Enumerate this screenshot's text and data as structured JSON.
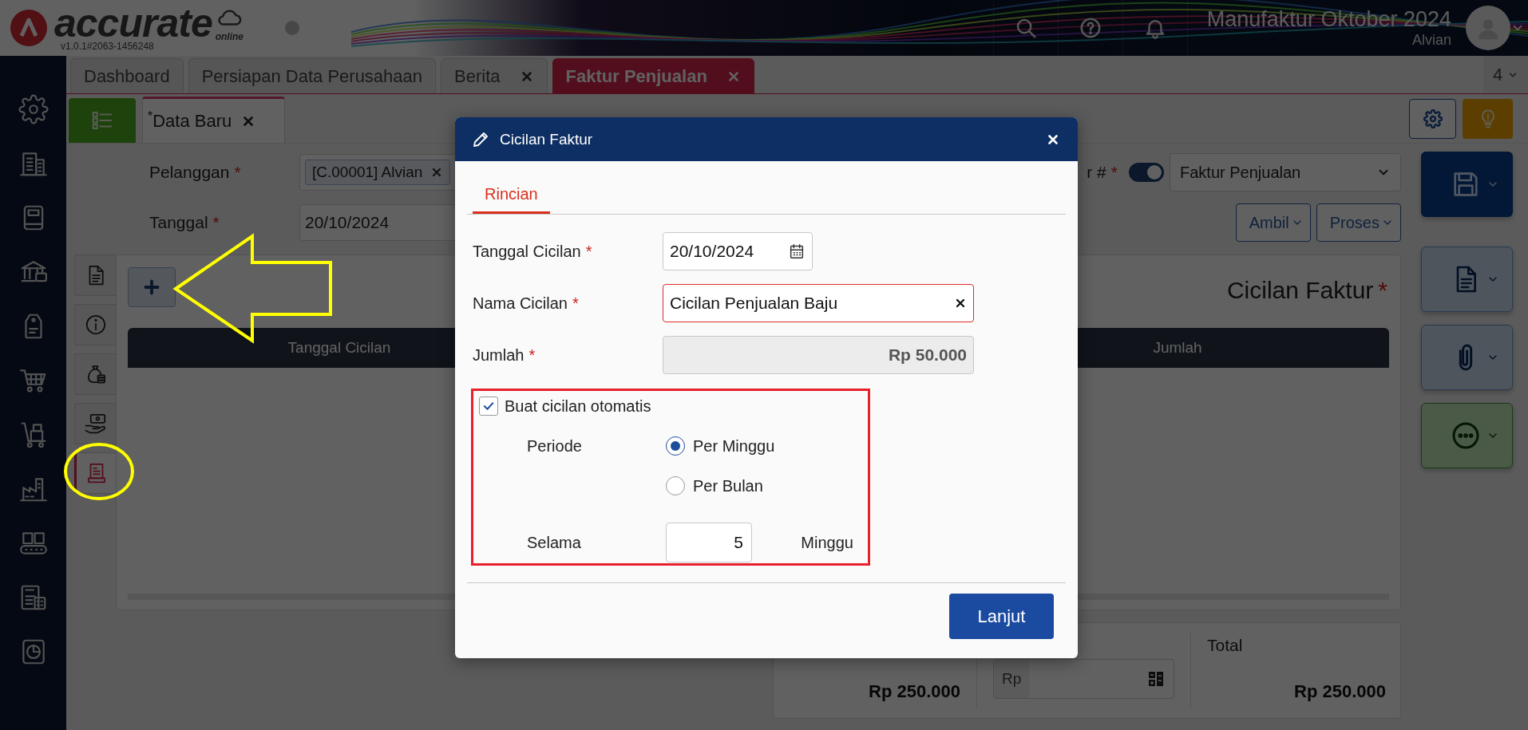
{
  "app": {
    "logo": "accurate",
    "edition": "online",
    "version": "v1.0.1#2063-1456248"
  },
  "header": {
    "company": "Manufaktur Oktober 2024",
    "user": "Alvian"
  },
  "tabs": [
    {
      "label": "Dashboard",
      "closable": false,
      "selected": false
    },
    {
      "label": "Persiapan Data Perusahaan",
      "closable": false,
      "selected": false
    },
    {
      "label": "Berita",
      "closable": true,
      "selected": false
    },
    {
      "label": "Faktur Penjualan",
      "closable": true,
      "selected": true
    }
  ],
  "tab_count": "4",
  "document_tabs": [
    {
      "label": "$^{*}$Data Baru",
      "selected": true
    }
  ],
  "form": {
    "fields": [
      {
        "kind": "chip",
        "label": "Pelanggan",
        "mark": "*",
        "value": "[C.00001] Alvian"
      },
      {
        "kind": "text",
        "label": "Tanggal",
        "mark": "*",
        "value": "20/10/2024"
      }
    ],
    "number_label": "r #",
    "number_mark": "*",
    "auto_number": true,
    "invoice_type": "Faktur Penjualan",
    "actions": [
      "Ambil",
      "Proses"
    ]
  },
  "side_tabs": [
    {
      "selected": false
    },
    {
      "selected": false
    },
    {
      "selected": false
    },
    {
      "selected": false
    },
    {
      "selected": true
    }
  ],
  "panel": {
    "title": "Cicilan Faktur",
    "mark": "*",
    "columns": [
      "Tanggal Cicilan",
      "Jumlah"
    ]
  },
  "totals": {
    "subtotal": "Rp 250.000",
    "currency": "Rp",
    "total_label": "Total",
    "total": "Rp 250.000"
  },
  "dialog": {
    "title": "Cicilan Faktur",
    "tabs": [
      {
        "label": "Rincian",
        "selected": true
      }
    ],
    "fields": [
      {
        "kind": "date",
        "label": "Tanggal Cicilan",
        "mark": "*",
        "value": "20/10/2024"
      },
      {
        "kind": "clearable",
        "label": "Nama Cicilan",
        "mark": "*",
        "value": "Cicilan Penjualan Baju",
        "focused": true
      },
      {
        "kind": "readonly",
        "label": "Jumlah",
        "mark": "*",
        "value": "Rp 50.000"
      }
    ],
    "auto": {
      "label": "Buat cicilan otomatis",
      "checked": true,
      "period_label": "Periode",
      "options": [
        {
          "label": "Per Minggu",
          "selected": true
        },
        {
          "label": "Per Bulan",
          "selected": false
        }
      ],
      "duration_label": "Selama",
      "duration": "5",
      "unit": "Minggu"
    },
    "submit": "Lanjut"
  }
}
